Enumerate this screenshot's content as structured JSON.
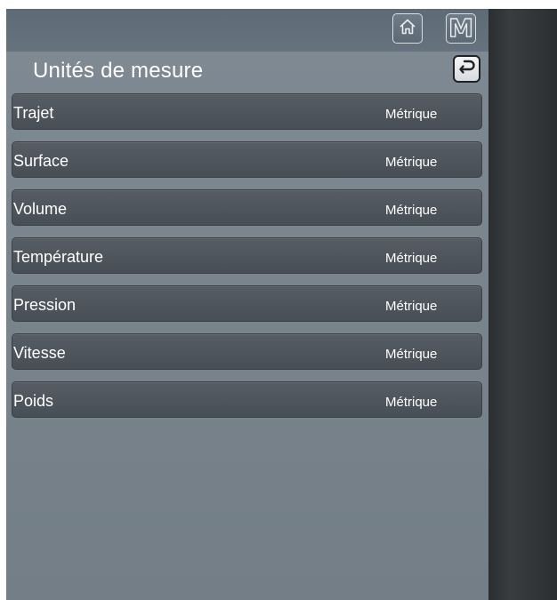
{
  "header": {
    "home_icon": "home-icon",
    "mode_label": "M",
    "title": "Unités de mesure",
    "back_icon": "back-arrow-icon"
  },
  "settings": [
    {
      "label": "Trajet",
      "value": "Métrique"
    },
    {
      "label": "Surface",
      "value": "Métrique"
    },
    {
      "label": "Volume",
      "value": "Métrique"
    },
    {
      "label": "Température",
      "value": "Métrique"
    },
    {
      "label": "Pression",
      "value": "Métrique"
    },
    {
      "label": "Vitesse",
      "value": "Métrique"
    },
    {
      "label": "Poids",
      "value": "Métrique"
    }
  ],
  "colors": {
    "panel": "#7a858e",
    "top_bar": "#627079",
    "row": "#50575e",
    "side_strip": "#303336",
    "text": "#ffffff"
  }
}
